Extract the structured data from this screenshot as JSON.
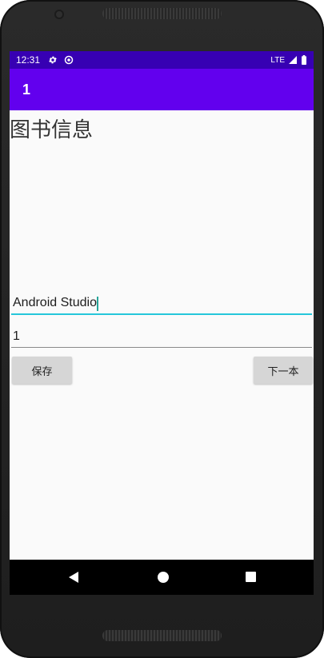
{
  "status_bar": {
    "time": "12:31",
    "network": "LTE",
    "icons": [
      "settings-icon",
      "vpn-icon",
      "signal-icon",
      "battery-icon"
    ]
  },
  "app_bar": {
    "title": "1"
  },
  "page": {
    "title": "图书信息"
  },
  "form": {
    "name_value": "Android Studio",
    "number_value": "1"
  },
  "buttons": {
    "save": "保存",
    "next": "下一本"
  },
  "colors": {
    "status_bar": "#3700b3",
    "app_bar": "#6200ee",
    "focus_underline": "#26c6da",
    "button_bg": "#d6d6d6"
  }
}
